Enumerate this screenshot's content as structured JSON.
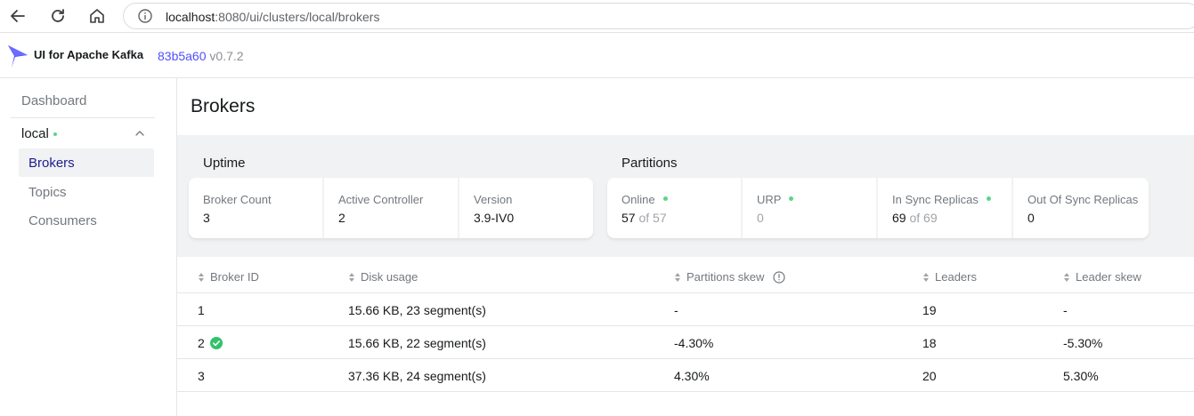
{
  "browser": {
    "url_host": "localhost",
    "url_rest": ":8080/ui/clusters/local/brokers"
  },
  "header": {
    "app_title": "UI for Apache Kafka",
    "commit_hash": "83b5a60",
    "version": "v0.7.2",
    "brand_color": "#4f4fff"
  },
  "sidebar": {
    "dashboard": "Dashboard",
    "cluster_name": "local",
    "cluster_status_color": "#5cd685",
    "items": [
      {
        "label": "Brokers",
        "active": true
      },
      {
        "label": "Topics",
        "active": false
      },
      {
        "label": "Consumers",
        "active": false
      }
    ]
  },
  "page": {
    "title": "Brokers"
  },
  "uptime": {
    "section_label": "Uptime",
    "broker_count_label": "Broker Count",
    "broker_count_value": "3",
    "active_controller_label": "Active Controller",
    "active_controller_value": "2",
    "version_label": "Version",
    "version_value": "3.9-IV0"
  },
  "partitions": {
    "section_label": "Partitions",
    "online_label": "Online",
    "online_value": "57",
    "online_total": "of 57",
    "urp_label": "URP",
    "urp_value": "0",
    "isr_label": "In Sync Replicas",
    "isr_value": "69",
    "isr_total": "of 69",
    "oosr_label": "Out Of Sync Replicas",
    "oosr_value": "0"
  },
  "table": {
    "columns": [
      "Broker ID",
      "Disk usage",
      "Partitions skew",
      "Leaders",
      "Leader skew"
    ],
    "rows": [
      {
        "broker_id": "1",
        "controller": false,
        "disk": "15.66 KB, 23 segment(s)",
        "partitions_skew": "-",
        "leaders": "19",
        "leader_skew": "-"
      },
      {
        "broker_id": "2",
        "controller": true,
        "disk": "15.66 KB, 22 segment(s)",
        "partitions_skew": "-4.30%",
        "leaders": "18",
        "leader_skew": "-5.30%"
      },
      {
        "broker_id": "3",
        "controller": false,
        "disk": "37.36 KB, 24 segment(s)",
        "partitions_skew": "4.30%",
        "leaders": "20",
        "leader_skew": "5.30%"
      }
    ]
  }
}
